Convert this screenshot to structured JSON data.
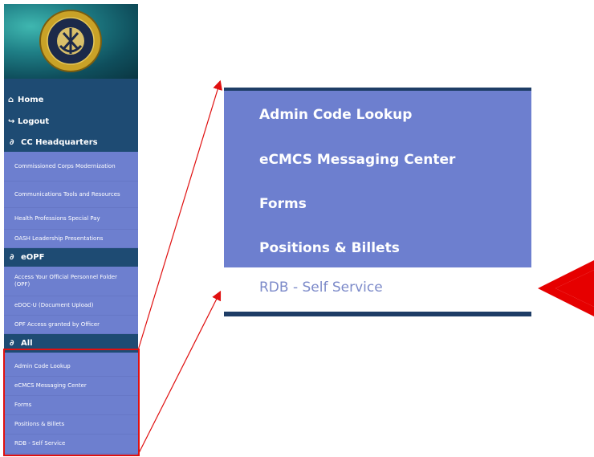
{
  "sidebar": {
    "logo_text_top": "U.S. PUBLIC HEALTH SERVICE",
    "logo_year": "1798",
    "home_label": "Home",
    "logout_label": "Logout",
    "sections": [
      {
        "title": "CC Headquarters",
        "items": [
          "Commissioned Corps Modernization",
          "Communications Tools and Resources",
          "Health Professions Special Pay",
          "OASH Leadership Presentations"
        ]
      },
      {
        "title": "eOPF",
        "items": [
          "Access Your Official Personnel Folder (OPF)",
          "eDOC-U (Document Upload)",
          "OPF Access granted by Officer"
        ]
      },
      {
        "title": "All",
        "items": [
          "Admin Code Lookup",
          "eCMCS Messaging Center",
          "Forms",
          "Positions & Billets",
          "RDB - Self Service"
        ]
      }
    ]
  },
  "zoom": {
    "items": [
      "Admin Code Lookup",
      "eCMCS Messaging Center",
      "Forms",
      "Positions & Billets"
    ],
    "highlighted_item": "RDB - Self Service"
  },
  "colors": {
    "sidebar_bg": "#6d7fcf",
    "section_header_bg": "#1e4b73",
    "highlight_red": "#e01010",
    "highlighted_text": "#7c8ac9"
  }
}
